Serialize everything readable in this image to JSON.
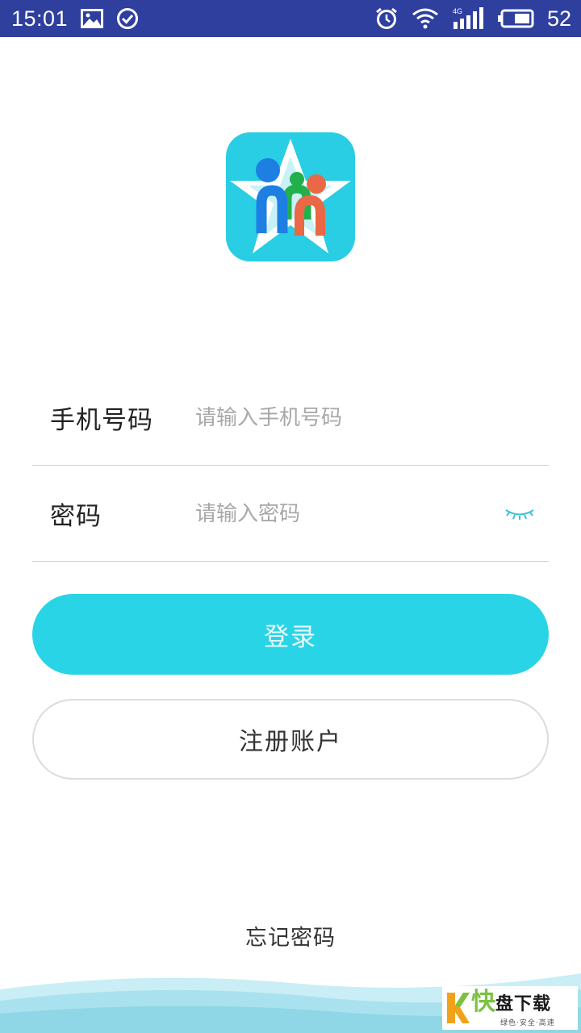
{
  "status_bar": {
    "time": "15:01",
    "battery_level": "52",
    "network": "4G",
    "icons": [
      "image-icon",
      "check-circle-icon",
      "alarm-icon",
      "wifi-icon",
      "signal-icon",
      "battery-icon"
    ]
  },
  "form": {
    "phone": {
      "label": "手机号码",
      "placeholder": "请输入手机号码",
      "value": ""
    },
    "password": {
      "label": "密码",
      "placeholder": "请输入密码",
      "value": ""
    }
  },
  "actions": {
    "login_label": "登录",
    "register_label": "注册账户",
    "forgot_label": "忘记密码"
  },
  "watermark": {
    "brand_first": "快",
    "brand_rest": "盘下载",
    "tagline": "绿色·安全·高速"
  },
  "colors": {
    "status_bar": "#2f3f9e",
    "accent": "#29d4e6",
    "logo_bg": "#29cde4"
  }
}
